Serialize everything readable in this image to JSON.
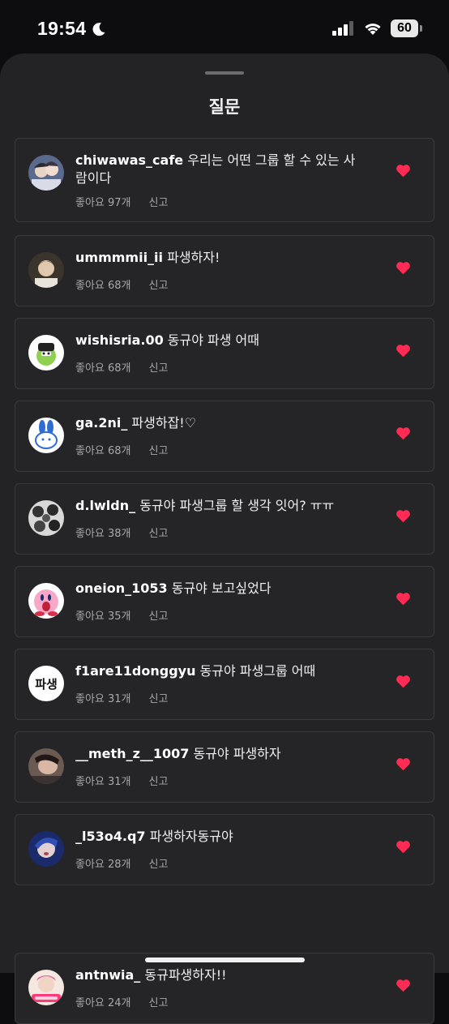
{
  "status_bar": {
    "time": "19:54",
    "battery": "60"
  },
  "sheet": {
    "title": "질문"
  },
  "comments": [
    {
      "username": "chiwawas_cafe",
      "text": " 우리는 어떤 그룹 할 수 있는 사람이다",
      "likes": "좋아요 97개",
      "report": "신고",
      "liked": true
    },
    {
      "username": "ummmmii_ii",
      "text": " 파생하자!",
      "likes": "좋아요 68개",
      "report": "신고",
      "liked": true
    },
    {
      "username": "wishisria.00",
      "text": " 동규야 파생 어때",
      "likes": "좋아요 68개",
      "report": "신고",
      "liked": true
    },
    {
      "username": "ga.2ni_",
      "text": " 파생하잡!♡",
      "likes": "좋아요 68개",
      "report": "신고",
      "liked": true
    },
    {
      "username": "d.lwldn_",
      "text": " 동규야 파생그룹 할 생각 잇어? ㅠㅠ",
      "likes": "좋아요 38개",
      "report": "신고",
      "liked": true
    },
    {
      "username": "oneion_1053",
      "text": " 동규야 보고싶었다",
      "likes": "좋아요 35개",
      "report": "신고",
      "liked": true
    },
    {
      "username": "f1are11donggyu",
      "text": " 동규야 파생그룹 어때",
      "likes": "좋아요 31개",
      "report": "신고",
      "liked": true,
      "avatar_text": "파생"
    },
    {
      "username": "__meth_z__1007",
      "text": " 동규야 파생하자",
      "likes": "좋아요 31개",
      "report": "신고",
      "liked": true
    },
    {
      "username": "_l53o4.q7",
      "text": " 파생하자동규야",
      "likes": "좋아요 28개",
      "report": "신고",
      "liked": true
    },
    {
      "username": "antnwia_",
      "text": " 동규파생하자!!",
      "likes": "좋아요 24개",
      "report": "신고",
      "liked": true
    }
  ],
  "colors": {
    "heart": "#fe2c55",
    "sheet_bg": "#232326",
    "card_border": "#3a3a3e"
  }
}
